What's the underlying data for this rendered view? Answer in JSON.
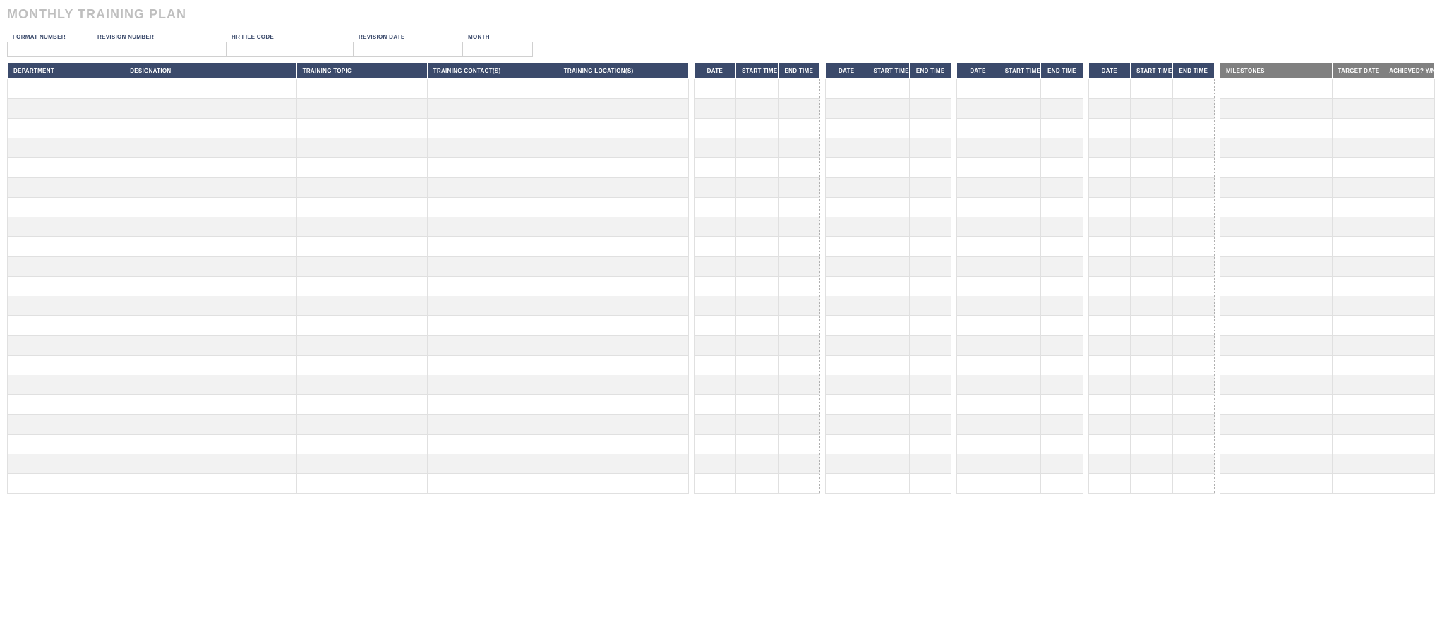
{
  "title": "MONTHLY TRAINING PLAN",
  "meta": {
    "format_number_label": "FORMAT NUMBER",
    "revision_number_label": "REVISION NUMBER",
    "hr_file_code_label": "HR FILE CODE",
    "revision_date_label": "REVISION DATE",
    "month_label": "MONTH",
    "format_number": "",
    "revision_number": "",
    "hr_file_code": "",
    "revision_date": "",
    "month": ""
  },
  "headers": {
    "department": "DEPARTMENT",
    "designation": "DESIGNATION",
    "training_topic": "TRAINING TOPIC",
    "training_contacts": "TRAINING CONTACT(S)",
    "training_locations": "TRAINING LOCATION(S)",
    "date": "DATE",
    "start_time": "START TIME",
    "end_time": "END TIME",
    "milestones": "MILESTONES",
    "target_date": "TARGET DATE",
    "achieved": "ACHIEVED? Y/N"
  },
  "row_count": 21,
  "schedule_group_count": 4
}
